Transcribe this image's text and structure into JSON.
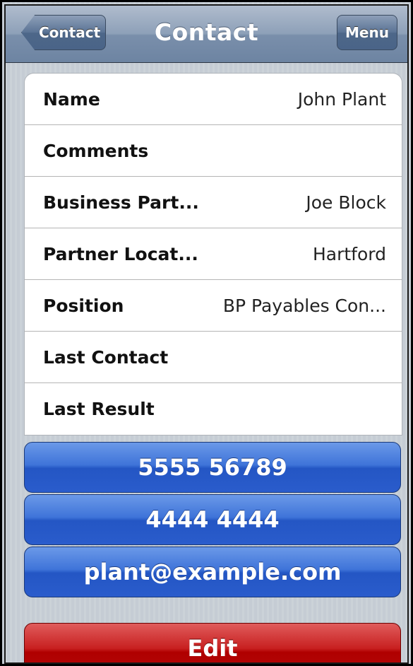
{
  "navbar": {
    "title": "Contact",
    "back_label": "Contact",
    "menu_label": "Menu"
  },
  "rows": [
    {
      "label": "Name",
      "value": "John Plant"
    },
    {
      "label": "Comments",
      "value": ""
    },
    {
      "label": "Business Part...",
      "value": "Joe Block"
    },
    {
      "label": "Partner Locat...",
      "value": "Hartford"
    },
    {
      "label": "Position",
      "value": "BP Payables Con..."
    },
    {
      "label": "Last Contact",
      "value": ""
    },
    {
      "label": "Last Result",
      "value": ""
    }
  ],
  "actions": {
    "phone1": "5555 56789",
    "phone2": "4444 4444",
    "email": "plant@example.com",
    "edit": "Edit"
  },
  "colors": {
    "navbar": "#7a8fab",
    "action_blue": "#2a5ccc",
    "edit_red": "#b30a0a"
  }
}
